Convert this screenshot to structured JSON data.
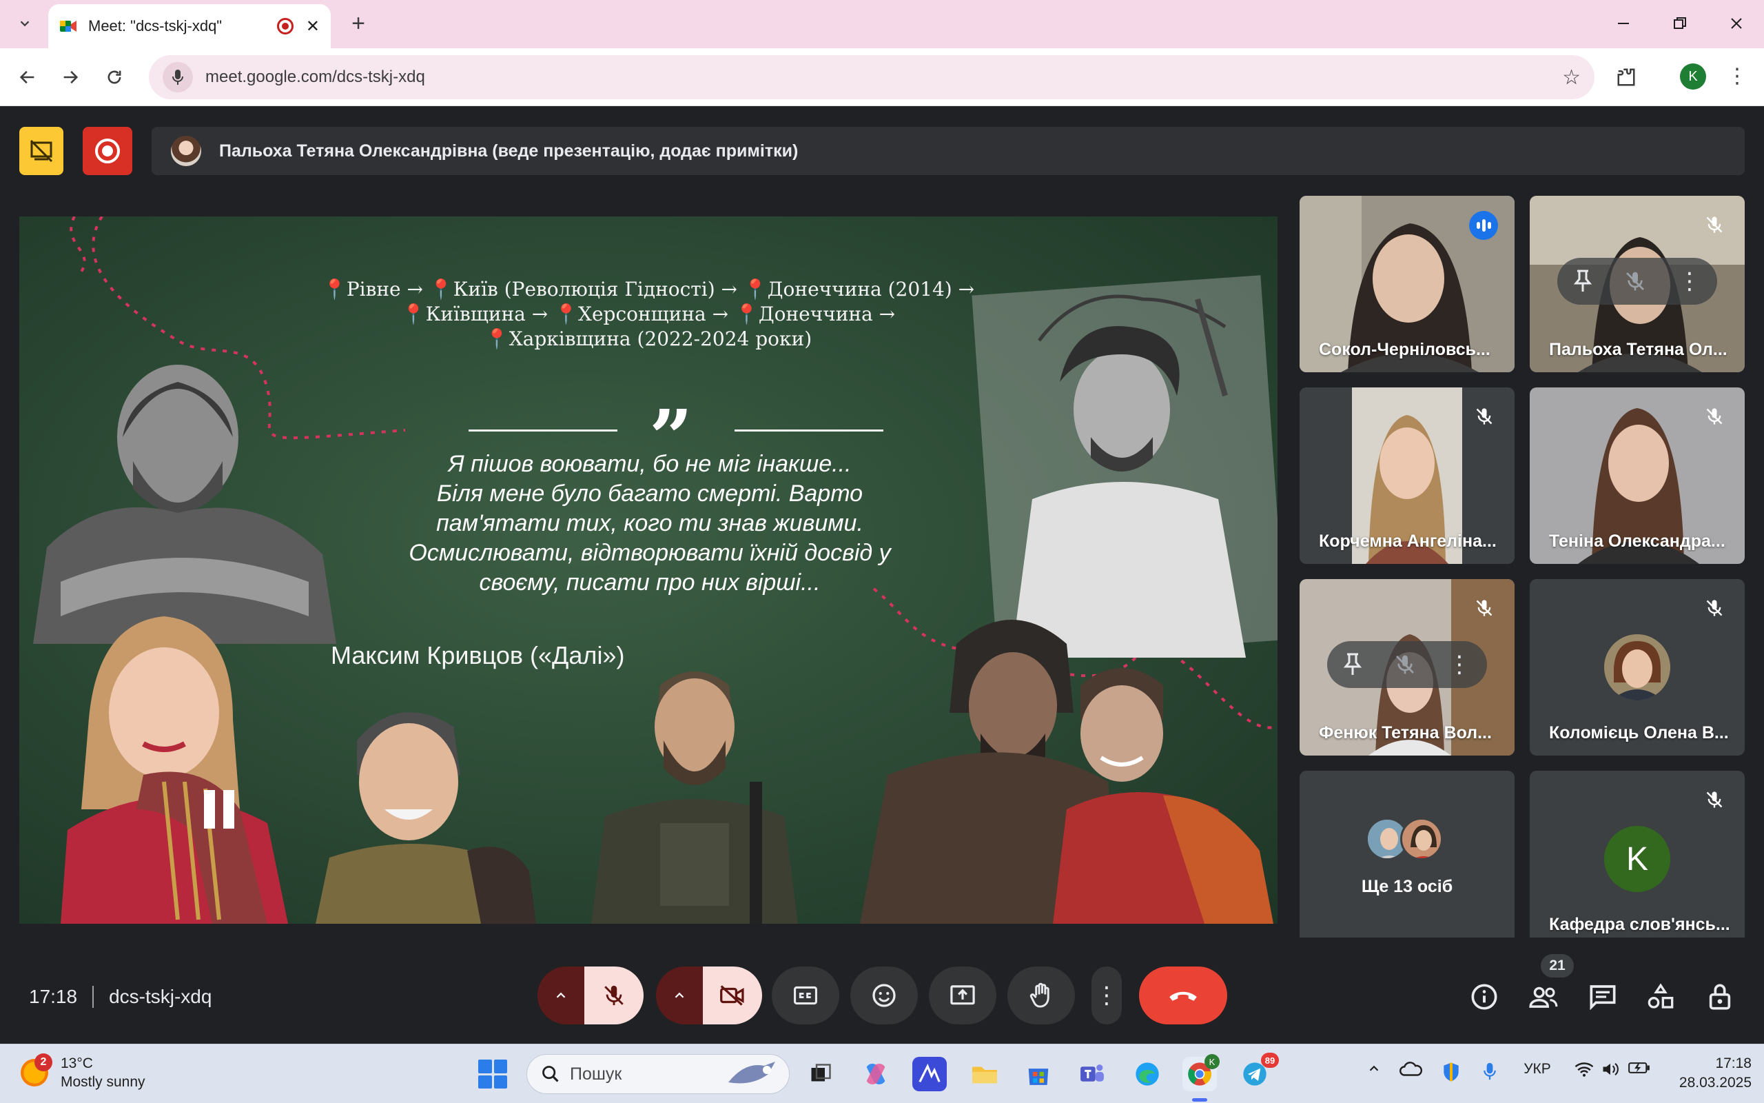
{
  "browser": {
    "tab_title": "Meet: \"dcs-tskj-xdq\"",
    "new_tab_symbol": "+",
    "url": "meet.google.com/dcs-tskj-xdq",
    "profile_initial": "K"
  },
  "meet": {
    "presenter_status": "Пальоха Тетяна Олександрівна (веде презентацію, додає примітки)",
    "slide": {
      "route_line1": "Рівне → ",
      "route_line1b": "Київ (Революція Гідності) → ",
      "route_line1c": "Донеччина  (2014) →",
      "route_line2": "Київщина  → ",
      "route_line2b": "Херсонщина → ",
      "route_line2c": "Донеччина →",
      "route_line3": "Харківщина (2022-2024 роки)",
      "quote_line1": "Я пішов воювати, бо не міг інакше...",
      "quote_line2": "Біля мене було багато смерті. Варто",
      "quote_line3": "пам'ятати тих, кого ти знав живими.",
      "quote_line4": "Осмислювати, відтворювати їхній досвід у",
      "quote_line5": "своєму, писати про них вірші...",
      "author": "Максим Кривцов («Далі»)"
    },
    "participants": [
      {
        "name": "Сокол-Чернiловсь...",
        "state": "speaking"
      },
      {
        "name": "Пальоха Тетяна Ол...",
        "state": "muted"
      },
      {
        "name": "Корчемна Ангеліна...",
        "state": "muted"
      },
      {
        "name": "Теніна Олександра...",
        "state": "muted"
      },
      {
        "name": "Фенюк Тетяна Вол...",
        "state": "muted"
      },
      {
        "name": "Коломієць Олена В...",
        "state": "muted"
      },
      {
        "name": "Ще 13 осіб",
        "state": "group"
      },
      {
        "name": "Кафедра слов'янсь...",
        "state": "muted",
        "initial": "K"
      }
    ],
    "time": "17:18",
    "meeting_code": "dcs-tskj-xdq",
    "people_count": "21",
    "colors": {
      "accent": "#8ab4f8",
      "end_call": "#ea4335",
      "mute_bg": "#f9dedc"
    }
  },
  "taskbar": {
    "weather_badge": "2",
    "temperature": "13°C",
    "weather_desc": "Mostly sunny",
    "search_placeholder": "Пошук",
    "telegram_badge": "89",
    "chrome_badge": "K",
    "language": "УКР",
    "clock_time": "17:18",
    "clock_date": "28.03.2025"
  }
}
